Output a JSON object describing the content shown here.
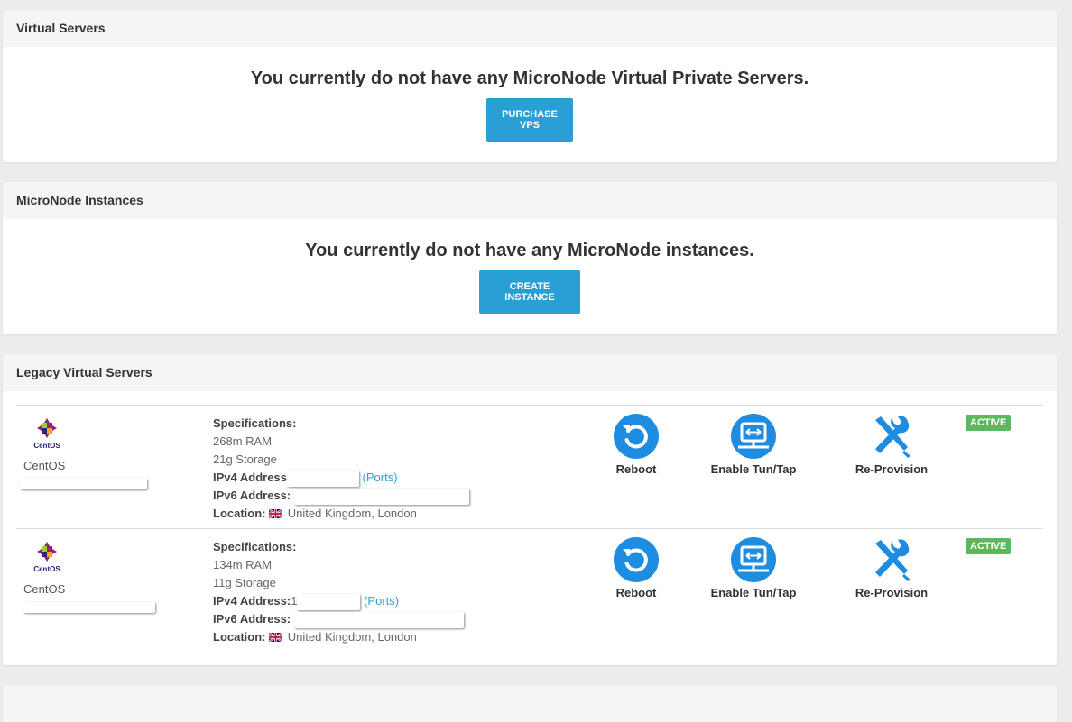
{
  "panels": {
    "virtual_servers": {
      "title": "Virtual Servers",
      "empty_message": "You currently do not have any MicroNode Virtual Private Servers.",
      "button": "PURCHASE VPS"
    },
    "micronode_instances": {
      "title": "MicroNode Instances",
      "empty_message": "You currently do not have any MicroNode instances.",
      "button": "CREATE INSTANCE"
    },
    "legacy": {
      "title": "Legacy Virtual Servers"
    }
  },
  "servers": [
    {
      "os_logo_text": "CentOS",
      "os_name": "CentOS",
      "specs_label": "Specifications:",
      "ram": "268m RAM",
      "storage": "21g Storage",
      "ipv4_label": "IPv4 Address",
      "ports": "(Ports)",
      "ipv6_label": "IPv6 Address:",
      "location_label": "Location:",
      "location": "United Kingdom, London",
      "actions": {
        "reboot": "Reboot",
        "tun": "Enable Tun/Tap",
        "reprovision": "Re-Provision"
      },
      "status": "ACTIVE"
    },
    {
      "os_logo_text": "CentOS",
      "os_name": "CentOS",
      "specs_label": "Specifications:",
      "ram": "134m RAM",
      "storage": "11g Storage",
      "ipv4_label": "IPv4 Address:",
      "ipv4_partial": "1",
      "ports": "(Ports)",
      "ipv6_label": "IPv6 Address:",
      "location_label": "Location:",
      "location": "United Kingdom, London",
      "actions": {
        "reboot": "Reboot",
        "tun": "Enable Tun/Tap",
        "reprovision": "Re-Provision"
      },
      "status": "ACTIVE"
    }
  ],
  "colors": {
    "accent": "#2a9fd6",
    "status_active": "#5cb85c",
    "icon_blue": "#1e8ce0"
  },
  "icons": [
    "centos-logo-icon",
    "reboot-icon",
    "tun-tap-icon",
    "reprovision-icon",
    "uk-flag-icon"
  ]
}
